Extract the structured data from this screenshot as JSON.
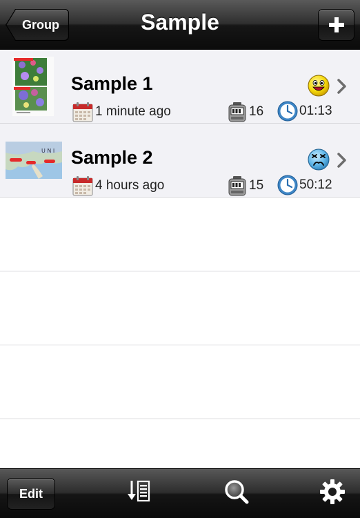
{
  "navbar": {
    "title": "Sample",
    "back_label": "Group",
    "add_icon": "plus-icon"
  },
  "items": [
    {
      "title": "Sample 1",
      "date": "1 minute ago",
      "count": "16",
      "duration": "01:13",
      "mood": "happy",
      "mood_color": "#f5d90a"
    },
    {
      "title": "Sample 2",
      "date": "4 hours ago",
      "count": "15",
      "duration": "50:12",
      "mood": "sad",
      "mood_color": "#5fb6e8"
    }
  ],
  "toolbar": {
    "edit_label": "Edit",
    "icons": [
      "sort-list-icon",
      "search-icon",
      "gear-icon"
    ]
  },
  "colors": {
    "bar_dark": "#161616",
    "row_bg": "#f2f2f6",
    "separator": "#d8d8dc"
  }
}
